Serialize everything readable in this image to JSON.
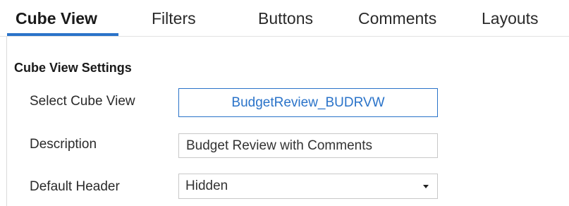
{
  "tabs": [
    {
      "label": "Cube View",
      "active": true
    },
    {
      "label": "Filters",
      "active": false
    },
    {
      "label": "Buttons",
      "active": false
    },
    {
      "label": "Comments",
      "active": false
    },
    {
      "label": "Layouts",
      "active": false
    }
  ],
  "settings": {
    "title": "Cube View Settings",
    "select_cube_view": {
      "label": "Select Cube View",
      "value": "BudgetReview_BUDRVW"
    },
    "description": {
      "label": "Description",
      "value": "Budget Review with Comments"
    },
    "default_header": {
      "label": "Default Header",
      "value": "Hidden",
      "icon": "caret-down-icon"
    }
  },
  "colors": {
    "accent": "#2a73c9",
    "border": "#c8c8c8"
  }
}
